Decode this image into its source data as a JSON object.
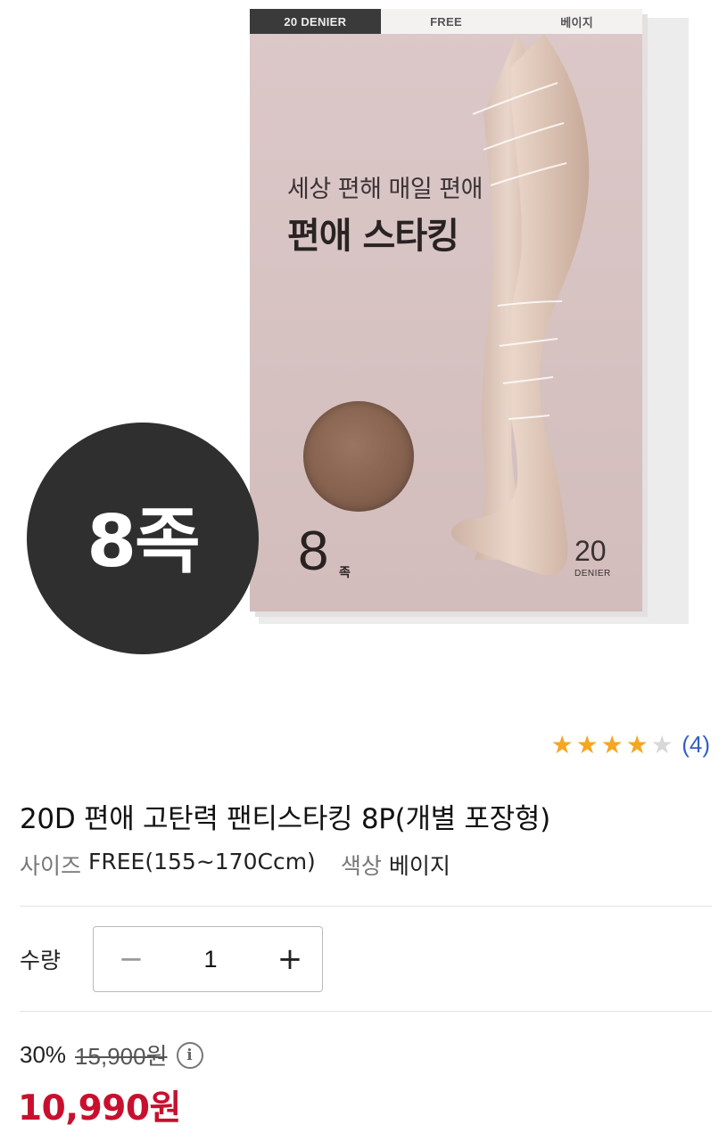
{
  "product_image": {
    "package_tabs": [
      "20 DENIER",
      "FREE",
      "베이지"
    ],
    "headline_sub": "세상 편해 매일 편애",
    "headline_main": "편애 스타킹",
    "pack_count": "8",
    "pack_unit": "족",
    "denier_value": "20",
    "denier_label": "DENIER",
    "badge_text": "8족",
    "swatch_color": "#86624f"
  },
  "rating": {
    "stars_filled": 4,
    "stars_total": 5,
    "review_count": "(4)",
    "star_color": "#f5a623"
  },
  "product": {
    "title": "20D 편애 고탄력 팬티스타킹 8P(개별 포장형)",
    "options": [
      {
        "label": "사이즈",
        "value": "FREE(155~170Ccm)"
      },
      {
        "label": "색상",
        "value": "베이지"
      }
    ]
  },
  "quantity": {
    "label": "수량",
    "value": "1",
    "minus": "−",
    "plus": "+"
  },
  "price": {
    "discount": "30%",
    "original": "15,900원",
    "info_icon": "i",
    "sale": "10,990원",
    "sale_color": "#c8102e"
  }
}
